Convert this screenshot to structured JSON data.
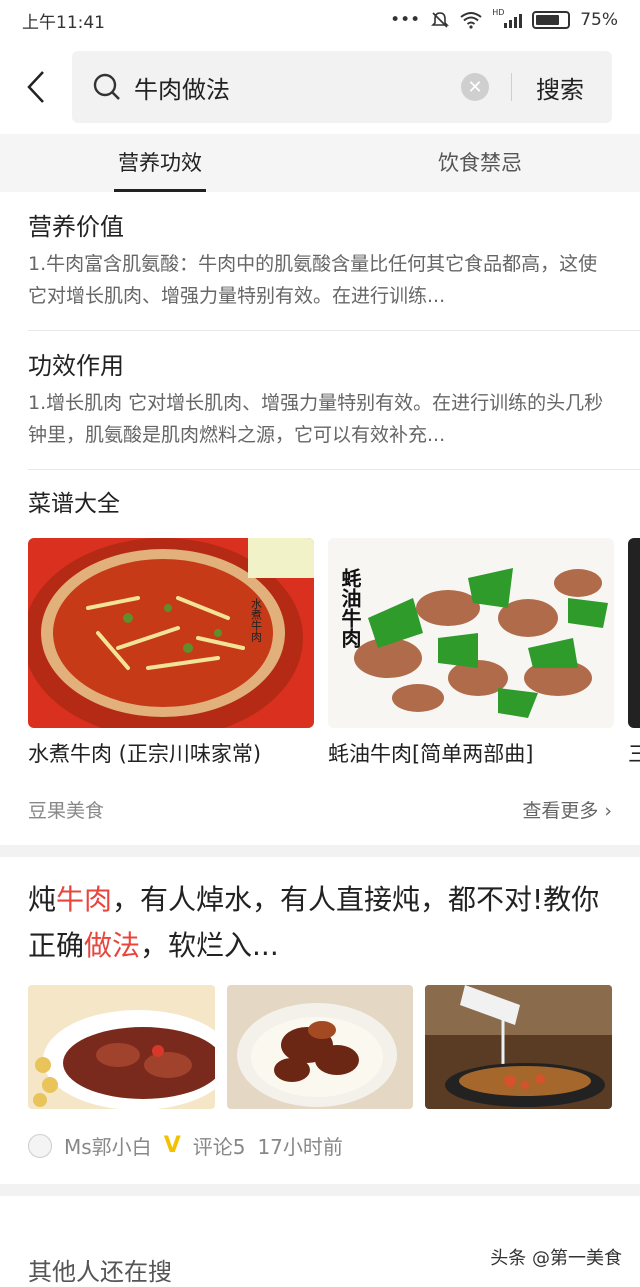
{
  "status_bar": {
    "time": "上午11:41",
    "signal_label": "HD",
    "battery": "75%",
    "battery_level": 0.75
  },
  "search": {
    "query": "牛肉做法",
    "button_label": "搜索"
  },
  "tabs": [
    {
      "label": "营养功效",
      "active": true
    },
    {
      "label": "饮食禁忌",
      "active": false
    }
  ],
  "nutrition": {
    "title": "营养价值",
    "desc": "1.牛肉富含肌氨酸：牛肉中的肌氨酸含量比任何其它食品都高，这使它对增长肌肉、增强力量特别有效。在进行训练..."
  },
  "effects": {
    "title": "功效作用",
    "desc": "1.增长肌肉 它对增长肌肉、增强力量特别有效。在进行训练的头几秒钟里，肌氨酸是肌肉燃料之源，它可以有效补充..."
  },
  "recipes": {
    "title": "菜谱大全",
    "items": [
      {
        "name": "水煮牛肉 (正宗川味家常)",
        "img_text": "水煮牛肉"
      },
      {
        "name": "蚝油牛肉[简单两部曲]",
        "img_text": "蚝油牛肉"
      },
      {
        "name": "三"
      }
    ],
    "source": "豆果美食",
    "more": "查看更多"
  },
  "article": {
    "title_parts": [
      "炖",
      "牛肉",
      "，有人焯水，有人直接炖，都不对!教你正确",
      "做法",
      "，软烂入..."
    ],
    "author": "Ms郭小白",
    "verified": "V",
    "comments": "评论5",
    "time": "17小时前"
  },
  "bottom": {
    "title": "其他人还在搜",
    "watermark": "头条 @第一美食"
  },
  "colors": {
    "highlight": "#e8453c",
    "verified": "#f2c200"
  }
}
